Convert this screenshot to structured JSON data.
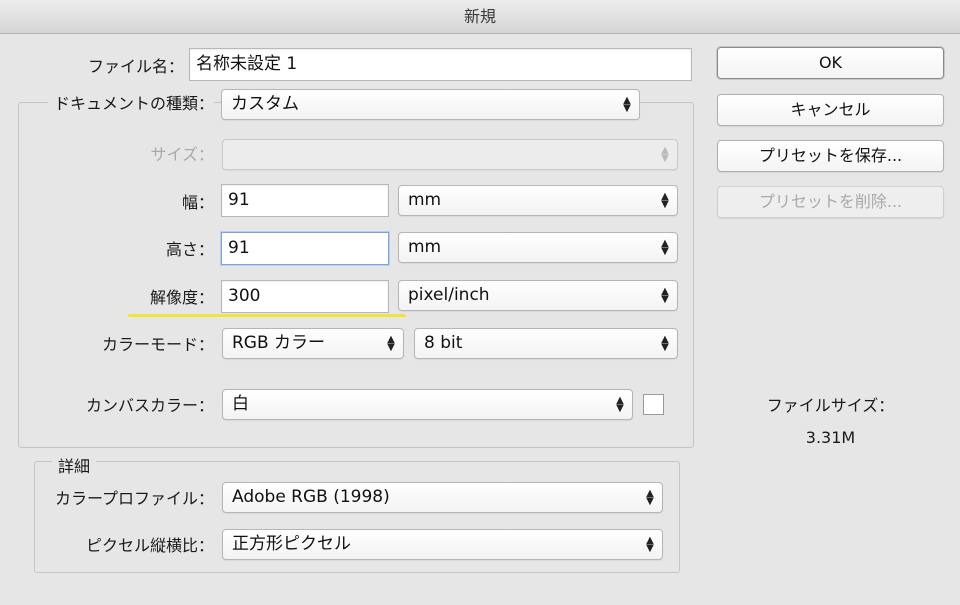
{
  "window": {
    "title": "新規"
  },
  "form": {
    "filename_label": "ファイル名：",
    "filename_value": "名称未設定 1",
    "doctype_label": "ドキュメントの種類：",
    "doctype_value": "カスタム",
    "size_label": "サイズ：",
    "size_value": "",
    "width_label": "幅：",
    "width_value": "91",
    "width_unit": "mm",
    "height_label": "高さ：",
    "height_value": "91",
    "height_unit": "mm",
    "resolution_label": "解像度：",
    "resolution_value": "300",
    "resolution_unit": "pixel/inch",
    "colormode_label": "カラーモード：",
    "colormode_value": "RGB カラー",
    "bitdepth_value": "8 bit",
    "canvas_label": "カンバスカラー：",
    "canvas_value": "白",
    "canvas_color": "#ffffff"
  },
  "advanced": {
    "legend": "詳細",
    "profile_label": "カラープロファイル：",
    "profile_value": "Adobe RGB (1998)",
    "aspect_label": "ピクセル縦横比：",
    "aspect_value": "正方形ピクセル"
  },
  "buttons": {
    "ok": "OK",
    "cancel": "キャンセル",
    "save_preset": "プリセットを保存...",
    "delete_preset": "プリセットを削除..."
  },
  "info": {
    "filesize_label": "ファイルサイズ：",
    "filesize_value": "3.31M"
  },
  "colors": {
    "highlight_underline": "#f2e33a",
    "focus_border": "#7fa4d8"
  }
}
